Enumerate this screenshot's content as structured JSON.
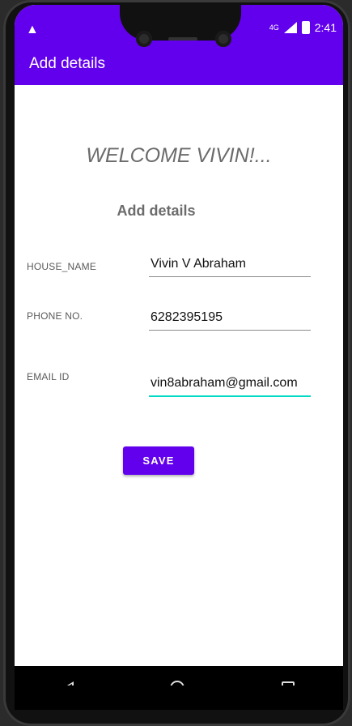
{
  "status_bar": {
    "warning_icon": "warning-triangle-icon",
    "network": "4G",
    "time": "2:41"
  },
  "appbar": {
    "title": "Add details",
    "color": "#6200ee"
  },
  "main": {
    "welcome": "WELCOME VIVIN!...",
    "section_title": "Add details",
    "fields": {
      "house_name": {
        "label": "HOUSE_NAME",
        "value": "Vivin V Abraham"
      },
      "phone": {
        "label": "PHONE NO.",
        "value": "6282395195"
      },
      "email": {
        "label": "EMAIL ID",
        "value": "vin8abraham@gmail.com"
      }
    },
    "save_label": "SAVE"
  },
  "colors": {
    "accent": "#6200ee",
    "focus_underline": "#03dac5"
  }
}
